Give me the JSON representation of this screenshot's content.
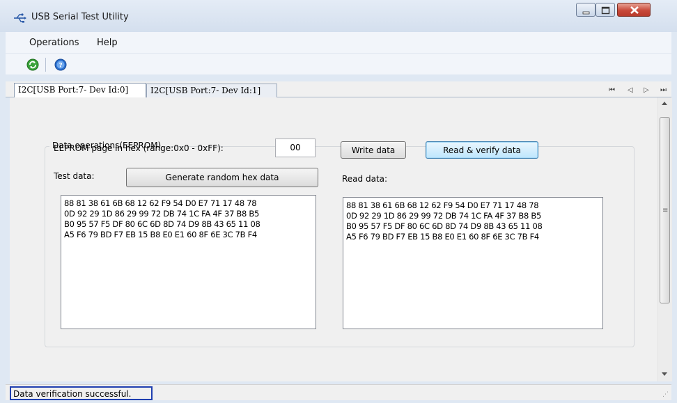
{
  "window": {
    "title": "USB Serial Test Utility"
  },
  "menu": {
    "items": [
      "Operations",
      "Help"
    ]
  },
  "toolbar": {
    "icons": [
      "refresh-icon",
      "help-icon"
    ],
    "colors": {
      "refresh": "#3aa33a",
      "help": "#2a6fd0"
    }
  },
  "tabs": [
    {
      "label": "I2C[USB Port:7- Dev Id:0]",
      "active": true
    },
    {
      "label": "I2C[USB Port:7- Dev Id:1]",
      "active": false
    }
  ],
  "tab_nav": {
    "first": "⏮",
    "prev": "◁",
    "next": "▷",
    "last": "⏭"
  },
  "eeprom": {
    "group_title": "Data operations(EEPROM)",
    "page_label": "EEPROM page in hex (range:0x0 - 0xFF):",
    "page_value": "00",
    "test_label": "Test data:",
    "generate_button": "Generate random hex data",
    "write_button": "Write data",
    "read_button": "Read & verify data",
    "read_label": "Read data:",
    "test_data": "88 81 38 61 6B 68 12 62 F9 54 D0 E7 71 17 48 78\n0D 92 29 1D 86 29 99 72 DB 74 1C FA 4F 37 B8 B5\nB0 95 57 F5 DF 80 6C 6D 8D 74 D9 8B 43 65 11 08\nA5 F6 79 BD F7 EB 15 B8 E0 E1 60 8F 6E 3C 7B F4",
    "read_data": "88 81 38 61 6B 68 12 62 F9 54 D0 E7 71 17 48 78\n0D 92 29 1D 86 29 99 72 DB 74 1C FA 4F 37 B8 B5\nB0 95 57 F5 DF 80 6C 6D 8D 74 D9 8B 43 65 11 08\nA5 F6 79 BD F7 EB 15 B8 E0 E1 60 8F 6E 3C 7B F4"
  },
  "status": {
    "text": "Data verification successful."
  }
}
